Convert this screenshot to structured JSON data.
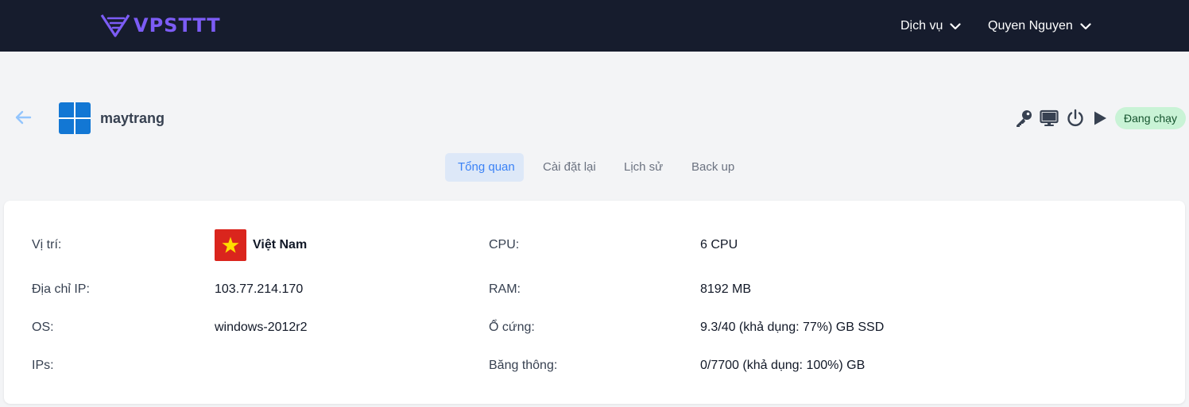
{
  "brand": {
    "name": "VPSTTT",
    "color": "#7c5cf5"
  },
  "nav": {
    "services": "Dịch vụ",
    "user": "Quyen Nguyen"
  },
  "vm": {
    "name": "maytrang",
    "os_icon": "windows-logo-icon",
    "status": "Đang chạy"
  },
  "actions": [
    "key-icon",
    "console-icon",
    "power-icon",
    "play-icon"
  ],
  "tabs": [
    {
      "label": "Tổng quan",
      "active": true
    },
    {
      "label": "Cài đặt lại",
      "active": false
    },
    {
      "label": "Lịch sử",
      "active": false
    },
    {
      "label": "Back up",
      "active": false
    }
  ],
  "details": {
    "location": {
      "label": "Vị trí:",
      "value": "Việt Nam",
      "flag": "vietnam-flag-icon"
    },
    "ip": {
      "label": "Địa chỉ IP:",
      "value": "103.77.214.170"
    },
    "os": {
      "label": "OS:",
      "value": "windows-2012r2"
    },
    "ips": {
      "label": "IPs:",
      "value": ""
    },
    "cpu": {
      "label": "CPU:",
      "value": "6 CPU"
    },
    "ram": {
      "label": "RAM:",
      "value": "8192 MB"
    },
    "disk": {
      "label": "Ổ cứng:",
      "value": "9.3/40 (khả dụng: 77%) GB SSD"
    },
    "bandwidth": {
      "label": "Băng thông:",
      "value": "0/7700 (khả dụng: 100%) GB"
    }
  },
  "colors": {
    "topbar": "#161c2d",
    "status_bg": "#c9f3d6",
    "active_tab": "#3b82f6",
    "windows_blue": "#1277d4"
  }
}
